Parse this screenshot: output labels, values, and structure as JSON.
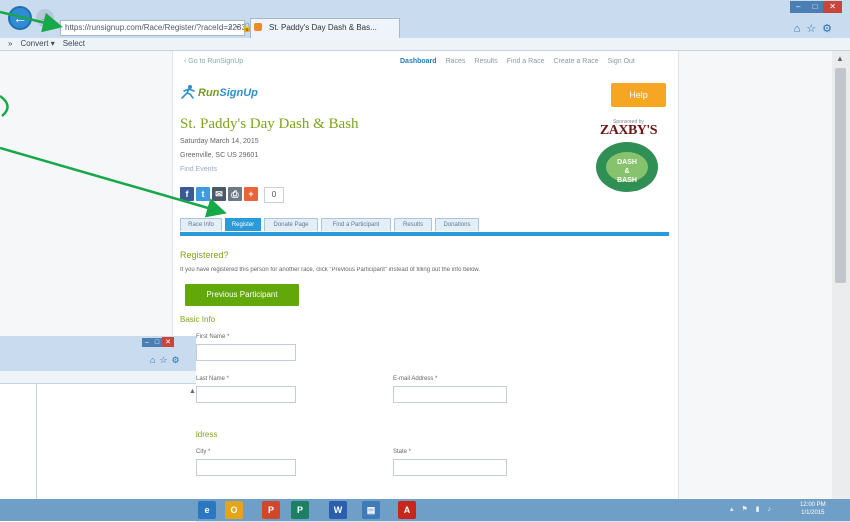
{
  "browser": {
    "address_url": "https://runsignup.com/Race/Register/?raceId=22336",
    "address_icons": "⌕ ▾ 🔒 C",
    "active_tab_title": "St. Paddy's Day Dash & Bas...",
    "window_controls": {
      "min": "–",
      "max": "□",
      "close": "✕"
    },
    "nav_icons": "⌂☆⚙",
    "command_bar": [
      "»",
      "Convert ▾",
      "Select"
    ]
  },
  "page": {
    "top_link": "‹ Go to RunSignUp",
    "top_nav": [
      "Dashboard",
      "Races",
      "Results",
      "Find a Race",
      "Create a Race",
      "Sign Out"
    ],
    "logo_main": "Run",
    "logo_accent": "SignUp",
    "signup_button": "Help",
    "event_title": "St. Paddy's Day Dash & Bash",
    "event_date": "Saturday March 14, 2015",
    "event_location": "Greenville, SC US 29601",
    "event_more": "Find Events",
    "sponsor": {
      "by": "Sponsored by",
      "name": "ZAXBY'S",
      "badge": "DASH\n&\nBASH"
    },
    "share": {
      "fb": "f",
      "tw": "t",
      "mail": "✉",
      "print": "⎙",
      "plus": "+",
      "count": "0"
    },
    "tabs": [
      "Race Info",
      "Register",
      "Donate Page",
      "Find a Participant",
      "Results",
      "Donations"
    ],
    "active_tab_index": 1,
    "registered_heading": "Registered?",
    "registered_text": "If you have registered this person for another race, click \"Previous Participant\" instead of filling out the info below.",
    "previous_participant_button": "Previous Participant",
    "basic_info_heading": "Basic Info",
    "fields": {
      "first_name_label": "First Name *",
      "last_name_label": "Last Name *",
      "email_label": "E-mail Address *",
      "city_label": "City *",
      "state_label": "State *"
    },
    "contact_heading": "Address"
  },
  "second_window": {
    "controls": {
      "min": "–",
      "max": "□",
      "close": "✕"
    },
    "nav_icons": "⌂☆⚙",
    "scroll_up": "▲"
  },
  "taskbar": {
    "apps": [
      {
        "name": "ie",
        "glyph": "e",
        "color": "#2b78c2"
      },
      {
        "name": "outlook",
        "glyph": "O",
        "color": "#e3a51c"
      },
      {
        "name": "powerpoint",
        "glyph": "P",
        "color": "#d2472a"
      },
      {
        "name": "publisher",
        "glyph": "P",
        "color": "#1b7f64"
      },
      {
        "name": "word",
        "glyph": "W",
        "color": "#2b5eab"
      },
      {
        "name": "explorer",
        "glyph": "▤",
        "color": "#3e7bb8"
      },
      {
        "name": "acrobat",
        "glyph": "A",
        "color": "#c8251b"
      }
    ],
    "tray_icons": "▴ ⚑ ▮ ♪",
    "clock_time": "12:00 PM",
    "clock_date": "1/1/2015"
  },
  "colors": {
    "runsignup_green": "#7ea419",
    "runsignup_blue": "#2a9bd8",
    "signup_orange": "#f6a623",
    "annotation_arrow": "#17a84a"
  }
}
